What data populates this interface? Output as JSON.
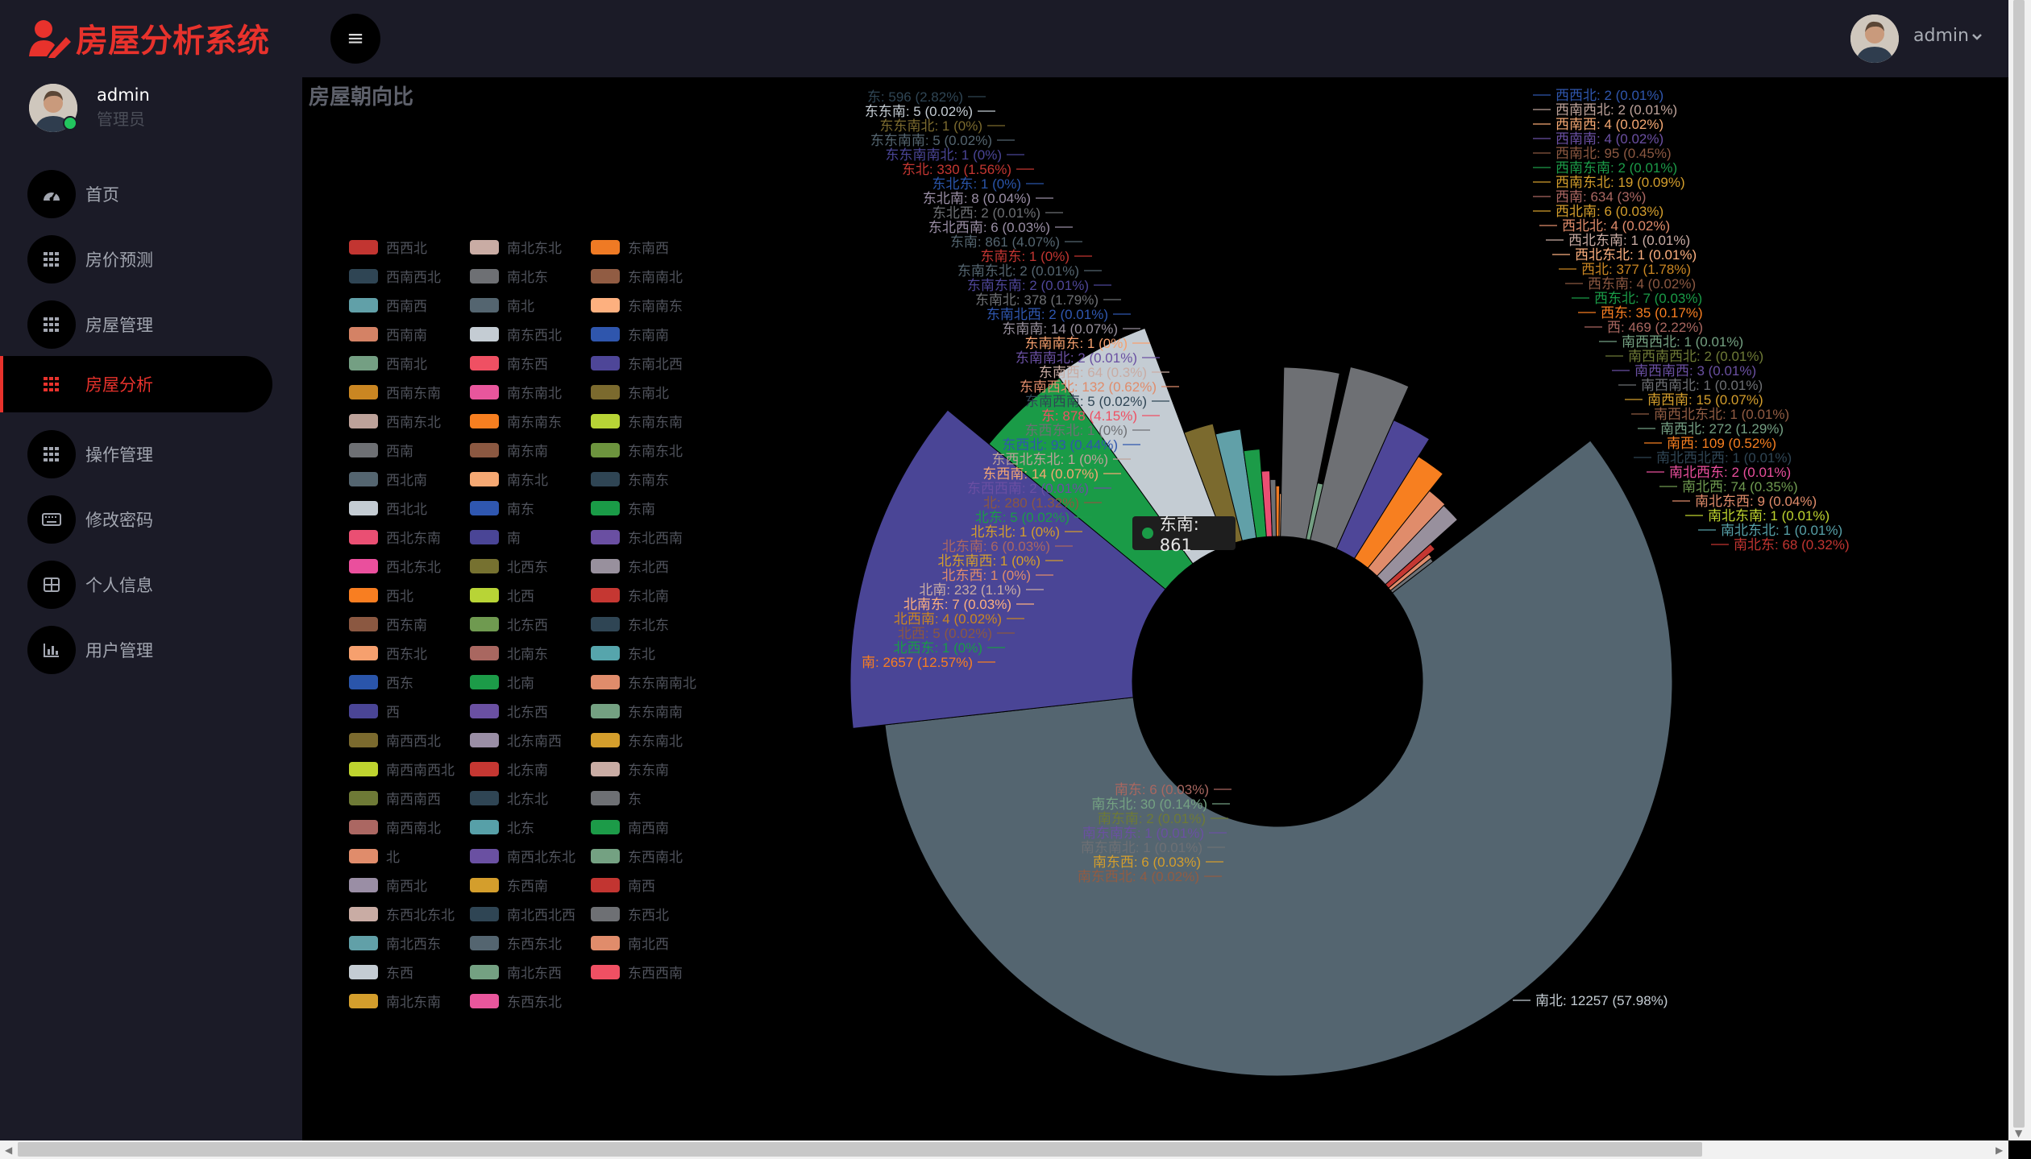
{
  "header": {
    "app_title": "房屋分析系统",
    "user_name": "admin"
  },
  "sidebar": {
    "name": "admin",
    "role": "管理员",
    "items": [
      {
        "label": "首页",
        "icon": "dashboard-icon"
      },
      {
        "label": "房价预测",
        "icon": "grid-icon"
      },
      {
        "label": "房屋管理",
        "icon": "grid-icon"
      },
      {
        "label": "房屋分析",
        "icon": "grid-icon"
      },
      {
        "label": "操作管理",
        "icon": "grid-icon"
      },
      {
        "label": "修改密码",
        "icon": "keyboard-icon"
      },
      {
        "label": "个人信息",
        "icon": "table-icon"
      },
      {
        "label": "用户管理",
        "icon": "bar-chart-icon"
      }
    ],
    "active_index": 3
  },
  "tooltip": {
    "text": "东南: 861"
  },
  "chart_data": {
    "type": "pie",
    "title": "房屋朝向比",
    "legend": [
      "西西北",
      "南北东北",
      "东南西",
      "西南西北",
      "南北东",
      "东南南北",
      "西南西",
      "南北",
      "东南南东",
      "西南南",
      "南东西北",
      "东南南",
      "西南北",
      "南东西",
      "东南北西",
      "西南东南",
      "南东南北",
      "东南北",
      "西南东北",
      "南东南东",
      "东南东南",
      "西南",
      "南东南",
      "东南东北",
      "西北南",
      "南东北",
      "东南东",
      "西北北",
      "南东",
      "东南",
      "西北东南",
      "南",
      "东北西南",
      "西北东北",
      "北西东",
      "东北西",
      "西北",
      "北西",
      "东北南",
      "西东南",
      "北东西",
      "东北东",
      "西东北",
      "北南东",
      "东北",
      "西东",
      "北南",
      "东东南南北",
      "西",
      "北东西",
      "东东南南",
      "南西西北",
      "北东南西",
      "东东南北",
      "南西南西北",
      "北东南",
      "东东南",
      "南西南西",
      "北东北",
      "东",
      "南西南北",
      "北东",
      "南西南",
      "北",
      "南西北东北",
      "东西南北",
      "南西北",
      "东西南",
      "南西",
      "东西北东北",
      "南北西北西",
      "东西北",
      "南北西东",
      "东西东北",
      "南北西",
      "东西",
      "南北东西",
      "东西西南",
      "南北东南",
      "东西东北"
    ],
    "legend_colors": [
      "#c23531",
      "#c9aca4",
      "#ef7a24",
      "#2f4554",
      "#6e7074",
      "#915c43",
      "#61a0a8",
      "#546570",
      "#fdb07f",
      "#d48265",
      "#c4ccd3",
      "#2f56ad",
      "#749f83",
      "#ef5063",
      "#4e4698",
      "#ca8622",
      "#e8569c",
      "#7b6a2e",
      "#bda29a",
      "#f77f20",
      "#b8d436",
      "#6e7074",
      "#8b5841",
      "#6d943e",
      "#546570",
      "#f5a873",
      "#2f4554",
      "#c4ccd3",
      "#2f57b0",
      "#1a9b47",
      "#ea4f73",
      "#4a4596",
      "#6a4fa2",
      "#ea4f9d",
      "#767130",
      "#98909d",
      "#f87e21",
      "#b8d436",
      "#c53732",
      "#8b5841",
      "#6f9a50",
      "#2f4554",
      "#f6a06e",
      "#a96760",
      "#56a5ac",
      "#2a55aa",
      "#1c9b48",
      "#e08c6b",
      "#4a4596",
      "#6a50a2",
      "#74a182",
      "#7b6a2e",
      "#9a8ea5",
      "#d49e2c",
      "#bfd42f",
      "#c53732",
      "#c9aca4",
      "#6e7a36",
      "#2f4554",
      "#6e7074",
      "#ab6762",
      "#57a0a8",
      "#1c9b48",
      "#e08c6b",
      "#6a50a2",
      "#74a182",
      "#9a8ea5",
      "#d49e2c",
      "#c23531",
      "#c9aca4",
      "#2f4554",
      "#6e7074",
      "#61a0a8",
      "#546570",
      "#e08c6b",
      "#c4ccd3",
      "#74a182",
      "#ef5063",
      "#d49e2c",
      "#e8569c"
    ],
    "slices": [
      {
        "name": "南北",
        "value": 12257,
        "pct": "57.98%",
        "color": "#546570"
      },
      {
        "name": "南",
        "value": 2657,
        "pct": "12.57%",
        "color": "#4a4596"
      },
      {
        "name": "东南",
        "value": 861,
        "pct": "4.07%",
        "color": "#1a9b47"
      },
      {
        "name": "东",
        "value": 878,
        "pct": "4.15%",
        "color": "#c4ccd3"
      },
      {
        "name": "西南",
        "value": 634,
        "pct": "3%",
        "color": "#6e7074"
      },
      {
        "name": "东",
        "value": 596,
        "pct": "2.82%",
        "color": "#6e7074"
      },
      {
        "name": "西",
        "value": 469,
        "pct": "2.22%",
        "color": "#4e4698"
      },
      {
        "name": "东南北",
        "value": 378,
        "pct": "1.79%",
        "color": "#7b6a2e"
      },
      {
        "name": "西北",
        "value": 377,
        "pct": "1.78%",
        "color": "#f77f20"
      },
      {
        "name": "东北",
        "value": 330,
        "pct": "1.56%",
        "color": "#61a0a8"
      },
      {
        "name": "北",
        "value": 280,
        "pct": "1.32%",
        "color": "#e08c6b"
      },
      {
        "name": "南西",
        "value": 272,
        "pct": "1.29%",
        "color": "#98909d"
      },
      {
        "name": "北南",
        "value": 232,
        "pct": "1.1%",
        "color": "#1c9b48"
      },
      {
        "name": "东南西北",
        "value": 132,
        "pct": "0.62%",
        "color": "#ea4f73"
      },
      {
        "name": "南西",
        "value": 109,
        "pct": "0.52%",
        "color": "#c53732"
      },
      {
        "name": "西南北",
        "value": 95,
        "pct": "0.45%",
        "color": "#749f83"
      },
      {
        "name": "东西北",
        "value": 93,
        "pct": "0.44%",
        "color": "#6e7074"
      },
      {
        "name": "南北西",
        "value": 74,
        "pct": "0.35%",
        "color": "#e08c6b"
      },
      {
        "name": "南北东北",
        "value": 68,
        "pct": "0.32%",
        "color": "#6e7074"
      },
      {
        "name": "东南西",
        "value": 64,
        "pct": "0.3%",
        "color": "#ef7a24"
      },
      {
        "name": "南东北",
        "value": 30,
        "pct": "0.14%",
        "color": "#f5a873"
      }
    ],
    "labels_left": [
      "东: 596 (2.82%)",
      "东东南: 5 (0.02%)",
      "东东南北: 1 (0%)",
      "东东南南: 5 (0.02%)",
      "东东南南北: 1 (0%)",
      "东北: 330 (1.56%)",
      "东北东: 1 (0%)",
      "东北南: 8 (0.04%)",
      "东北西: 2 (0.01%)",
      "东北西南: 6 (0.03%)",
      "东南: 861 (4.07%)",
      "东南东: 1 (0%)",
      "东南东北: 2 (0.01%)",
      "东南东南: 2 (0.01%)",
      "东南北: 378 (1.79%)",
      "东南北西: 2 (0.01%)",
      "东南南: 14 (0.07%)",
      "东南南东: 1 (0%)",
      "东南南北: 2 (0.01%)",
      "东南西: 64 (0.3%)",
      "东南西北: 132 (0.62%)",
      "东南西南: 5 (0.02%)",
      "东: 878 (4.15%)",
      "东西东北: 1 (0%)",
      "东西北: 93 (0.44%)",
      "东西北东北: 1 (0%)",
      "东西南: 14 (0.07%)",
      "东西西南: 2 (0.01%)",
      "北: 280 (1.32%)",
      "北东: 5 (0.02%)",
      "北东北: 1 (0%)",
      "北东南: 6 (0.03%)",
      "北东南西: 1 (0%)",
      "北东西: 1 (0%)",
      "北南: 232 (1.1%)",
      "北南东: 7 (0.03%)",
      "北西南: 4 (0.02%)",
      "北西: 5 (0.02%)",
      "北西东: 1 (0%)",
      "南: 2657 (12.57%)",
      "南东: 6 (0.03%)",
      "南东北: 30 (0.14%)",
      "南东南: 2 (0.01%)",
      "南东南东: 1 (0.01%)",
      "南东南北: 1 (0.01%)",
      "南东西: 6 (0.03%)",
      "南东西北: 4 (0.02%)"
    ],
    "labels_right": [
      "西西北: 2 (0.01%)",
      "西南西北: 2 (0.01%)",
      "西南西: 4 (0.02%)",
      "西南南: 4 (0.02%)",
      "西南北: 95 (0.45%)",
      "西南东南: 2 (0.01%)",
      "西南东北: 19 (0.09%)",
      "西南: 634 (3%)",
      "西北南: 6 (0.03%)",
      "西北北: 4 (0.02%)",
      "西北东南: 1 (0.01%)",
      "西北东北: 1 (0.01%)",
      "西北: 377 (1.78%)",
      "西东南: 4 (0.02%)",
      "西东北: 7 (0.03%)",
      "西东: 35 (0.17%)",
      "西: 469 (2.22%)",
      "南西西北: 1 (0.01%)",
      "南西南西北: 2 (0.01%)",
      "南西南西: 3 (0.01%)",
      "南西南北: 1 (0.01%)",
      "南西南: 15 (0.07%)",
      "南西北东北: 1 (0.01%)",
      "南西北: 272 (1.29%)",
      "南西: 109 (0.52%)",
      "南北西北西: 1 (0.01%)",
      "南北西东: 2 (0.01%)",
      "南北西: 74 (0.35%)",
      "南北东西: 9 (0.04%)",
      "南北东南: 1 (0.01%)",
      "南北东北: 1 (0.01%)",
      "南北东: 68 (0.32%)",
      "南北: 12257 (57.98%)"
    ]
  }
}
